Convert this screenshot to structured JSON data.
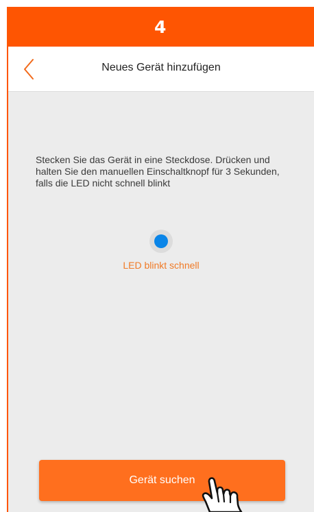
{
  "banner": {
    "step": "4"
  },
  "header": {
    "title": "Neues Gerät hinzufügen",
    "back_icon": "chevron-left-icon"
  },
  "main": {
    "instructions": "Stecken Sie das Gerät in eine Steckdose. Drücken und halten Sie den manuellen Einschaltknopf für 3 Sekunden, falls die LED nicht schnell blinkt",
    "led_label": "LED blinkt schnell"
  },
  "footer": {
    "search_button": "Gerät suchen",
    "cursor_icon": "hand-pointer-icon"
  },
  "colors": {
    "banner": "#fe5502",
    "accent": "#ff6f1e",
    "led": "#0a85e8",
    "caption": "#f07a26",
    "background": "#ececec"
  }
}
